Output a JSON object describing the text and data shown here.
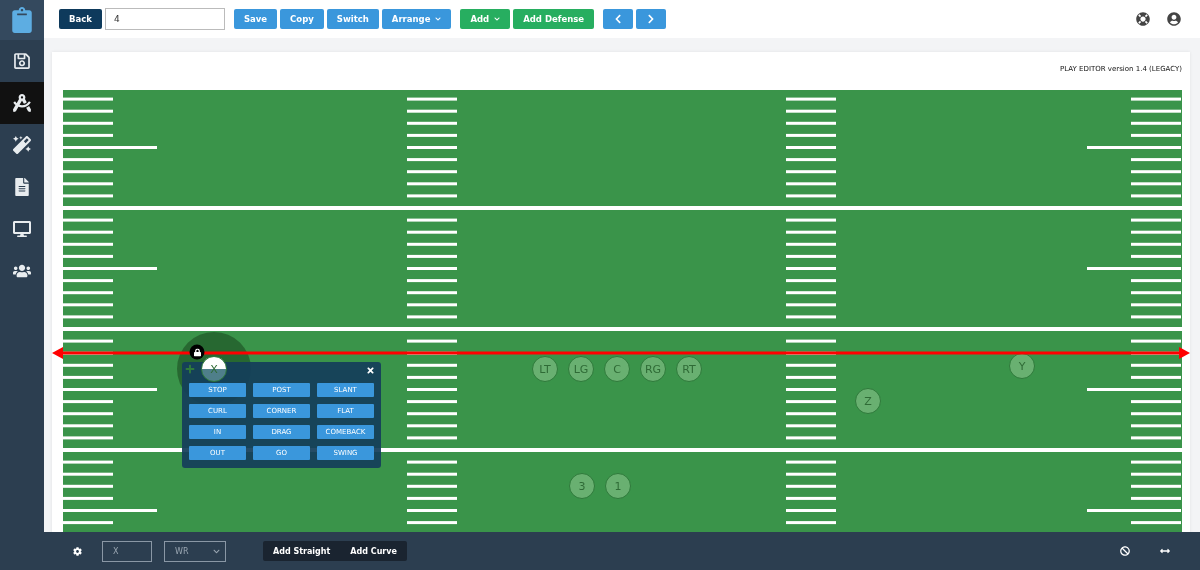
{
  "sidebar": {
    "items": [
      {
        "selected": false
      },
      {
        "selected": false
      },
      {
        "selected": true
      },
      {
        "selected": false
      },
      {
        "selected": false
      },
      {
        "selected": false
      },
      {
        "selected": false
      }
    ]
  },
  "toolbar": {
    "buttons": [
      {
        "label": "Back",
        "kind": "dark",
        "dropdown": false
      },
      {
        "kind": "input",
        "value": "4"
      },
      {
        "label": "Save",
        "kind": "blue",
        "dropdown": false
      },
      {
        "label": "Copy",
        "kind": "blue",
        "dropdown": false
      },
      {
        "label": "Switch",
        "kind": "blue",
        "dropdown": false
      },
      {
        "label": "Arrange",
        "kind": "blue",
        "dropdown": true
      },
      {
        "label": "Add",
        "kind": "green",
        "dropdown": true
      },
      {
        "label": "Add Defense",
        "kind": "green",
        "dropdown": false
      }
    ]
  },
  "version": "PLAY EDITOR version 1.4 (LEGACY)",
  "players": [
    {
      "label": "X",
      "selected": true
    },
    {
      "label": "LT",
      "selected": false
    },
    {
      "label": "LG",
      "selected": false
    },
    {
      "label": "C",
      "selected": false
    },
    {
      "label": "RG",
      "selected": false
    },
    {
      "label": "RT",
      "selected": false
    },
    {
      "label": "Y",
      "selected": false
    },
    {
      "label": "Z",
      "selected": false
    },
    {
      "label": "3",
      "selected": false
    },
    {
      "label": "1",
      "selected": false
    }
  ],
  "route_menu": {
    "routes": [
      "STOP",
      "POST",
      "SLANT",
      "CURL",
      "CORNER",
      "FLAT",
      "IN",
      "DRAG",
      "COMEBACK",
      "OUT",
      "GO",
      "SWING"
    ]
  },
  "bottom_bar": {
    "label_field": {
      "placeholder": "X"
    },
    "position_select": {
      "placeholder": "WR"
    },
    "buttons": [
      "Add Straight",
      "Add Curve"
    ]
  }
}
